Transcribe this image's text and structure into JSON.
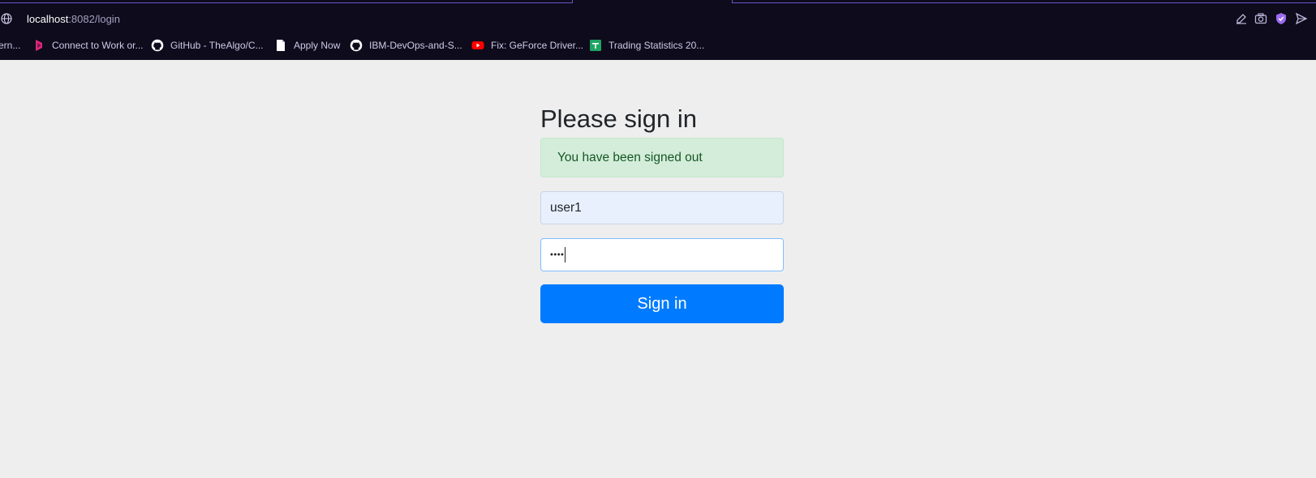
{
  "browser": {
    "url_host": "localhost",
    "url_path": ":8082/login",
    "toolbar_icons": [
      "edit-icon",
      "camera-icon",
      "shield-extension-icon",
      "send-icon"
    ],
    "bookmarks": [
      {
        "label": "ern...",
        "icon": "none"
      },
      {
        "label": "Connect to Work or...",
        "icon": "power-apps-icon"
      },
      {
        "label": "GitHub - TheAlgo/C...",
        "icon": "github-icon"
      },
      {
        "label": "Apply Now",
        "icon": "document-icon"
      },
      {
        "label": "IBM-DevOps-and-S...",
        "icon": "github-icon"
      },
      {
        "label": "Fix: GeForce Driver...",
        "icon": "youtube-icon"
      },
      {
        "label": "Trading Statistics 20...",
        "icon": "sheets-icon"
      }
    ]
  },
  "login": {
    "heading": "Please sign in",
    "alert": "You have been signed out",
    "username_value": "user1",
    "password_mask": "••••",
    "submit_label": "Sign in"
  },
  "colors": {
    "page_bg": "#eeeeee",
    "chrome_bg": "#0e0b1c",
    "primary": "#007bff",
    "alert_bg": "#d4edda",
    "alert_text": "#155724"
  }
}
